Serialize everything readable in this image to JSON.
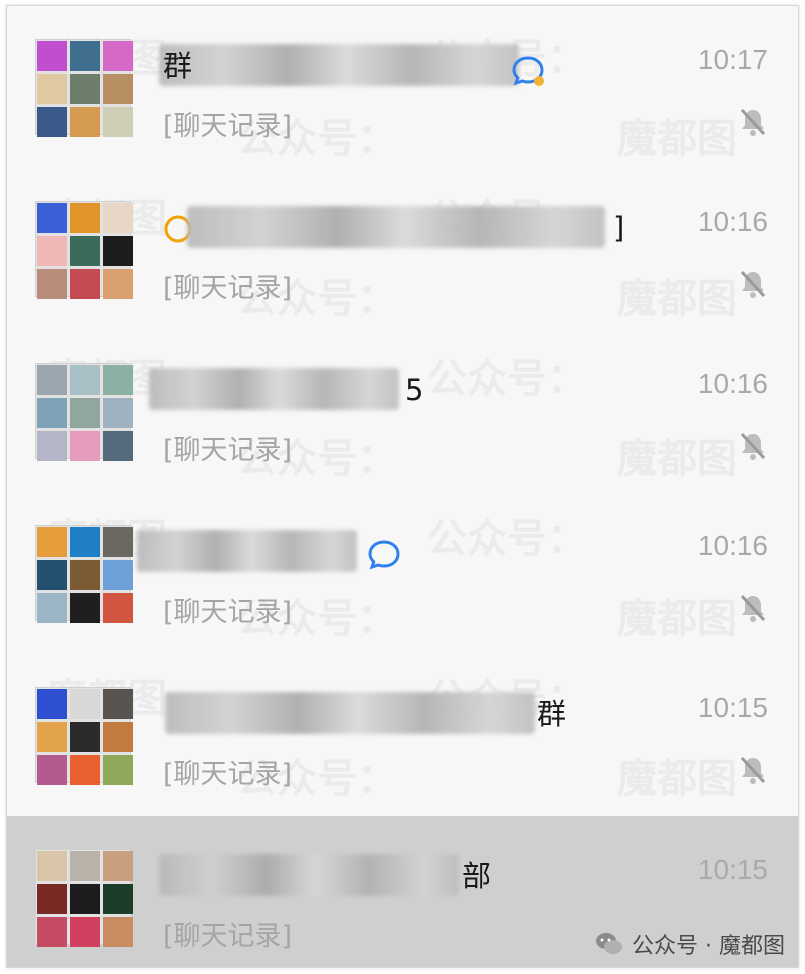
{
  "conversations": [
    {
      "name_visible": "群",
      "name_suffix": "",
      "time": "10:17",
      "preview": "[聊天记录]",
      "has_chat_badge": true,
      "colors": [
        "#c04fd0",
        "#3f6e8f",
        "#d46ac6",
        "#e0c8a0",
        "#6d7f6a",
        "#b78f62",
        "#3a5b8a",
        "#d59b52",
        "#cfcfb8"
      ]
    },
    {
      "name_visible": "",
      "name_suffix": "]",
      "time": "10:16",
      "preview": "[聊天记录]",
      "has_chat_badge": false,
      "colors": [
        "#3b5fd7",
        "#e0952b",
        "#e8d6c6",
        "#f0b7b7",
        "#3a6b5c",
        "#1d1d1d",
        "#b98b7a",
        "#c44b52",
        "#d9a070"
      ]
    },
    {
      "name_visible": "",
      "name_suffix": "5",
      "time": "10:16",
      "preview": "[聊天记录]",
      "has_chat_badge": false,
      "colors": [
        "#9aa7b1",
        "#a6c0c5",
        "#8bb0a4",
        "#7fa3b6",
        "#92a6a0",
        "#9fb2c2",
        "#b5b5c8",
        "#e59bbb",
        "#556a7b"
      ]
    },
    {
      "name_visible": "",
      "name_suffix": "",
      "time": "10:16",
      "preview": "[聊天记录]",
      "has_chat_badge": true,
      "colors": [
        "#e59c3a",
        "#1f7fc6",
        "#6b6860",
        "#23506e",
        "#7a5b33",
        "#6ea0d8",
        "#9bb7c7",
        "#1f1f1f",
        "#d1553f"
      ]
    },
    {
      "name_visible": "",
      "name_suffix": "群",
      "time": "10:15",
      "preview": "[聊天记录]",
      "has_chat_badge": false,
      "colors": [
        "#2d4fd0",
        "#d8d8d8",
        "#5a5451",
        "#e3a34a",
        "#2b2b2b",
        "#c27a3f",
        "#b35a8e",
        "#e86030",
        "#8ea85a"
      ]
    },
    {
      "name_visible": "",
      "name_suffix": "部",
      "time": "10:15",
      "preview": "[聊天记录]",
      "has_chat_badge": false,
      "colors": [
        "#d9c6a8",
        "#b8b2a8",
        "#c9a07f",
        "#7a2a24",
        "#1c1c1c",
        "#1d3d2b",
        "#c64c63",
        "#d1405e",
        "#c98b62"
      ]
    }
  ],
  "watermark": {
    "text": "魔都图",
    "text2": "公众号："
  },
  "footer": {
    "label": "公众号 · 魔都图"
  }
}
